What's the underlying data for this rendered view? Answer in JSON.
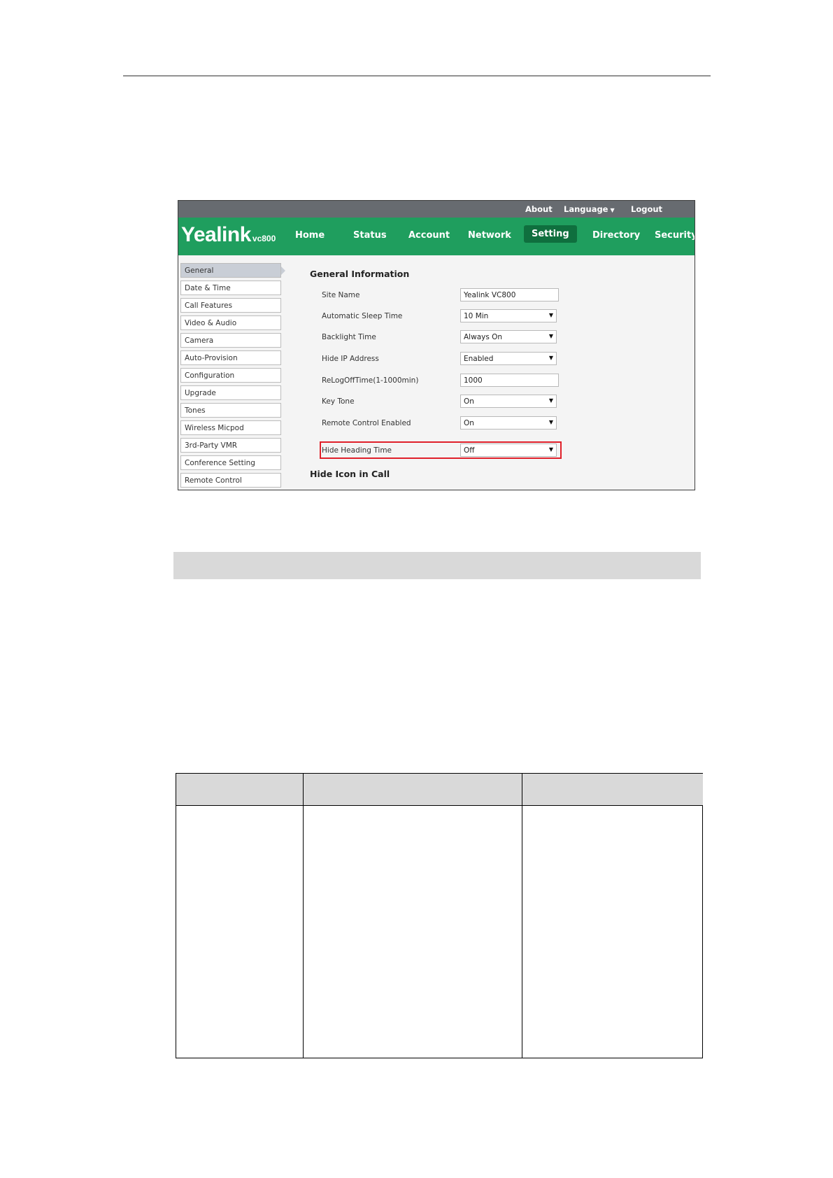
{
  "topbar": {
    "about": "About",
    "language": "Language",
    "language_caret": "▼",
    "logout": "Logout"
  },
  "logo": {
    "word": "Yealink",
    "model": "vc800"
  },
  "nav": {
    "home": "Home",
    "status": "Status",
    "account": "Account",
    "network": "Network",
    "setting": "Setting",
    "directory": "Directory",
    "security": "Security"
  },
  "sidebar": {
    "items": [
      "General",
      "Date & Time",
      "Call Features",
      "Video & Audio",
      "Camera",
      "Auto-Provision",
      "Configuration",
      "Upgrade",
      "Tones",
      "Wireless Micpod",
      "3rd-Party VMR",
      "Conference Setting",
      "Remote Control"
    ]
  },
  "sections": {
    "general": "General Information",
    "hide_icon": "Hide Icon in Call"
  },
  "form": {
    "site_name": {
      "label": "Site Name",
      "value": "Yealink VC800"
    },
    "sleep_time": {
      "label": "Automatic Sleep Time",
      "value": "10 Min"
    },
    "backlight": {
      "label": "Backlight Time",
      "value": "Always On"
    },
    "hide_ip": {
      "label": "Hide IP Address",
      "value": "Enabled"
    },
    "relogoff": {
      "label": "ReLogOffTime(1-1000min)",
      "value": "1000"
    },
    "key_tone": {
      "label": "Key Tone",
      "value": "On"
    },
    "remote_control": {
      "label": "Remote Control Enabled",
      "value": "On"
    },
    "hide_heading": {
      "label": "Hide Heading Time",
      "value": "Off"
    }
  },
  "icons": {
    "select_arrow": "▼"
  },
  "colors": {
    "nav_green": "#1f9e5e",
    "active_tab": "#0f6f3e",
    "highlight_red": "#e0202a"
  }
}
